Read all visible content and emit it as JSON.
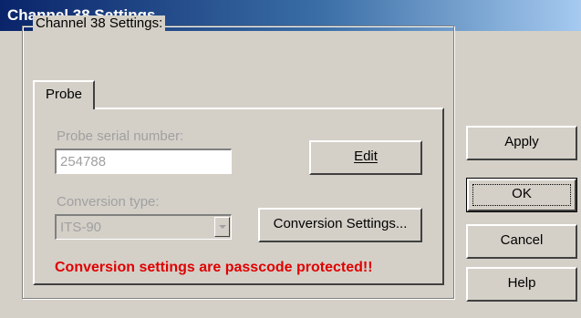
{
  "window": {
    "title": "Channel 38 Settings"
  },
  "group": {
    "label": "Channel 38 Settings:"
  },
  "tabs": [
    {
      "label": "Probe",
      "selected": true
    }
  ],
  "probe": {
    "serial_label": "Probe serial number:",
    "serial_value": "254788",
    "edit_button": "Edit",
    "conversion_label": "Conversion type:",
    "conversion_value": "ITS-90",
    "conversion_settings_button": "Conversion Settings...",
    "warning": "Conversion settings are passcode protected!!"
  },
  "buttons": {
    "apply": "Apply",
    "ok": "OK",
    "cancel": "Cancel",
    "help": "Help"
  },
  "colors": {
    "title_gradient_start": "#0a246a",
    "warning_text": "#e00000",
    "disabled_text": "#a0a0a0",
    "dialog_bg": "#d4d0c8"
  }
}
